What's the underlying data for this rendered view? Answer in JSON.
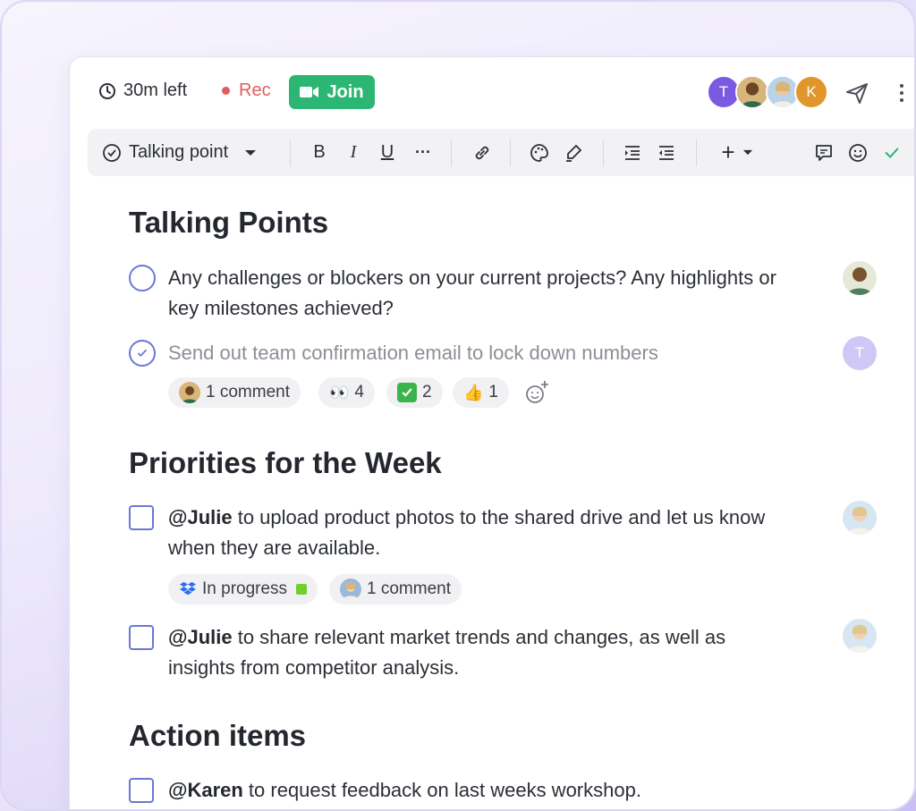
{
  "header": {
    "timer": "30m left",
    "rec": "Rec",
    "join": "Join",
    "participants": [
      {
        "initial": "T",
        "color": "#7a5ae0"
      },
      {
        "initial": "",
        "color": "#8a6a3a"
      },
      {
        "initial": "",
        "color": "#9ab8d8"
      },
      {
        "initial": "K",
        "color": "#e0962b"
      }
    ]
  },
  "toolbar": {
    "block_type": "Talking point",
    "bold": "B",
    "italic": "I",
    "underline": "U",
    "more": "···",
    "add": "+"
  },
  "sections": {
    "talking_points": {
      "title": "Talking Points",
      "items": [
        {
          "text": "Any challenges or blockers on your current projects? Any highlights or key milestones achieved?"
        },
        {
          "text": "Send out team confirmation email to lock down numbers",
          "assignee_initial": "T"
        }
      ],
      "reactions": {
        "comment": "1 comment",
        "eyes_count": "4",
        "check_count": "2",
        "thumbs_count": "1"
      }
    },
    "priorities": {
      "title": "Priorities for the Week",
      "items": [
        {
          "mention": "@Julie",
          "text": " to upload product photos to the shared drive and let us know when they are available."
        },
        {
          "mention": "@Julie",
          "text": " to share relevant market trends and changes, as well as insights from competitor analysis."
        }
      ],
      "chips": {
        "status": "In progress",
        "comment": "1 comment"
      }
    },
    "action_items": {
      "title": "Action items",
      "items": [
        {
          "mention": "@Karen",
          "text": " to request feedback on last weeks workshop."
        }
      ]
    }
  },
  "colors": {
    "accent": "#6b78d6",
    "join": "#2bb673",
    "rec": "#e05d5d",
    "status_green": "#6fd02b"
  }
}
